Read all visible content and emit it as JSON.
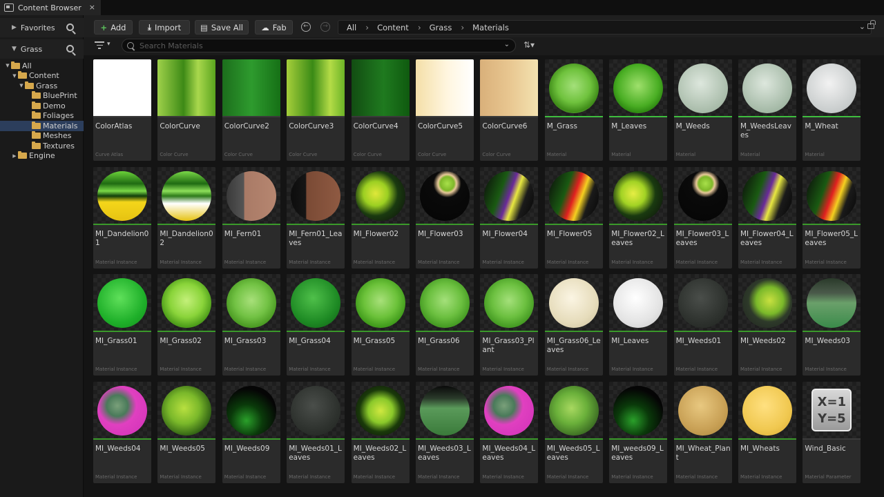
{
  "tab": {
    "title": "Content Browser",
    "close": "×"
  },
  "sidebar": {
    "favorites": "Favorites",
    "grass": "Grass",
    "tree": [
      {
        "label": "All",
        "level": 0,
        "twisty": "▼"
      },
      {
        "label": "Content",
        "level": 1,
        "twisty": "▼"
      },
      {
        "label": "Grass",
        "level": 2,
        "twisty": "▼"
      },
      {
        "label": "BluePrint",
        "level": 3,
        "twisty": ""
      },
      {
        "label": "Demo",
        "level": 3,
        "twisty": ""
      },
      {
        "label": "Foliages",
        "level": 3,
        "twisty": ""
      },
      {
        "label": "Materials",
        "level": 3,
        "twisty": "",
        "selected": true
      },
      {
        "label": "Meshes",
        "level": 3,
        "twisty": ""
      },
      {
        "label": "Textures",
        "level": 3,
        "twisty": ""
      },
      {
        "label": "Engine",
        "level": 1,
        "twisty": "▶"
      }
    ]
  },
  "toolbar": {
    "add": "Add",
    "import": "Import",
    "save_all": "Save All",
    "fab": "Fab",
    "breadcrumb": [
      "All",
      "Content",
      "Grass",
      "Materials"
    ]
  },
  "search": {
    "placeholder": "Search Materials"
  },
  "assets": [
    {
      "name": "ColorAtlas",
      "type": "Curve Atlas",
      "kind": "flat",
      "fill": "#ffffff",
      "bar": "#3a3a3a"
    },
    {
      "name": "ColorCurve",
      "type": "Color Curve",
      "kind": "flat",
      "fill": "linear-gradient(90deg,#9fd14a,#3d8a16 45%,#a9d84d 70%,#5aa41e)",
      "bar": "#3a3a3a"
    },
    {
      "name": "ColorCurve2",
      "type": "Color Curve",
      "kind": "flat",
      "fill": "linear-gradient(90deg,#1c6e1c,#2e9b2e 50%,#167016)",
      "bar": "#3a3a3a"
    },
    {
      "name": "ColorCurve3",
      "type": "Color Curve",
      "kind": "flat",
      "fill": "linear-gradient(90deg,#a6cf3a,#3a8a16 45%,#b4dc47 75%,#6cb326)",
      "bar": "#3a3a3a"
    },
    {
      "name": "ColorCurve4",
      "type": "Color Curve",
      "kind": "flat",
      "fill": "linear-gradient(90deg,#124d12,#1f7a1f 55%,#0f5a0f)",
      "bar": "#3a3a3a"
    },
    {
      "name": "ColorCurve5",
      "type": "Color Curve",
      "kind": "flat",
      "fill": "linear-gradient(90deg,#f4dfa8,#fff6e0 55%,#ffffff)",
      "bar": "#3a3a3a"
    },
    {
      "name": "ColorCurve6",
      "type": "Color Curve",
      "kind": "flat",
      "fill": "linear-gradient(90deg,#d9b07a,#e8c690 50%,#f3e2b0)",
      "bar": "#3a3a3a"
    },
    {
      "name": "M_Grass",
      "type": "Material",
      "fill": "radial-gradient(circle at 50% 45%,#a4e07a 0%,#6fc23d 45%,#3e8a18 70%,#b4ef9a 100%)",
      "bar": "#3fbf3f"
    },
    {
      "name": "M_Leaves",
      "type": "Material",
      "fill": "radial-gradient(circle at 50% 45%,#9fe06c 0%,#4aae24 55%,#2f8a12 72%,#b8f39a 100%)",
      "bar": "#3fbf3f"
    },
    {
      "name": "M_Weeds",
      "type": "Material",
      "fill": "radial-gradient(circle at 45% 40%,#dde7dd,#a9bcaa 70%,#8ba08b)",
      "bar": "#3fbf3f"
    },
    {
      "name": "M_WeedsLeaves",
      "type": "Material",
      "fill": "radial-gradient(circle at 45% 40%,#dde7dd,#a4b9a6 70%,#889f8a)",
      "bar": "#3fbf3f"
    },
    {
      "name": "M_Wheat",
      "type": "Material",
      "fill": "radial-gradient(circle at 45% 40%,#f2f2f2,#c8cccc 70%,#a6aaaa)",
      "bar": "#3fbf3f"
    },
    {
      "name": "MI_Dandelion01",
      "type": "Material Instance",
      "fill": "linear-gradient(180deg,#6bd13a 0%,#1f6b12 25%,#7ad847 40%,#0f3d0a 50%,#f4d61a 62%,#e6c212 100%)",
      "bar": "#3a9a2a"
    },
    {
      "name": "MI_Dandelion02",
      "type": "Material Instance",
      "fill": "linear-gradient(180deg,#7ad847 0%,#1f6b12 25%,#8ee05a 40%,#2d7a1a 50%,#ffffff 65%,#e6c212 100%)",
      "bar": "#3a9a2a"
    },
    {
      "name": "MI_Fern01",
      "type": "Material Instance",
      "fill": "linear-gradient(90deg,#3a3a3a 0%,#555 35%,#a97a66 36%,#b68670 100%)",
      "bar": "#3a9a2a"
    },
    {
      "name": "MI_Fern01_Leaves",
      "type": "Material Instance",
      "fill": "linear-gradient(90deg,#0d0d0d 0%,#151515 30%,#7a4a35 32%,#8f5a42 100%)",
      "bar": "#3a9a2a"
    },
    {
      "name": "MI_Flower02",
      "type": "Material Instance",
      "fill": "radial-gradient(circle at 40% 45%,#dfe83a 0%,#9ccf22 30%,#1a3a10 55%,#0a0a0a 100%)",
      "bar": "#3a9a2a"
    },
    {
      "name": "MI_Flower03",
      "type": "Material Instance",
      "fill": "radial-gradient(circle at 55% 25%,#a8e04a 0%,#7fb82a 15%,#e8c89a 20%,#0a0a0a 30%,#050505 100%)",
      "bar": "#3a9a2a"
    },
    {
      "name": "MI_Flower04",
      "type": "Material Instance",
      "fill": "linear-gradient(110deg,#0a0a0a 0%,#1a5a12 35%,#6a2a9a 50%,#e8e840 60%,#1a1a1a 75%,#050505 100%)",
      "bar": "#3a9a2a"
    },
    {
      "name": "MI_Flower05",
      "type": "Material Instance",
      "fill": "linear-gradient(110deg,#0a0a0a 0%,#1a5a12 35%,#e02020 50%,#f4d020 62%,#1a1a1a 75%,#050505 100%)",
      "bar": "#3a9a2a"
    },
    {
      "name": "MI_Flower02_Leaves",
      "type": "Material Instance",
      "fill": "radial-gradient(circle at 40% 45%,#e6ee44 0%,#a2d224 30%,#1a3a10 55%,#0a0a0a 100%)",
      "bar": "#3a9a2a"
    },
    {
      "name": "MI_Flower03_Leaves",
      "type": "Material Instance",
      "fill": "radial-gradient(circle at 55% 25%,#a8e04a 0%,#7fb82a 15%,#e8c89a 20%,#0a0a0a 30%,#050505 100%)",
      "bar": "#3a9a2a"
    },
    {
      "name": "MI_Flower04_Leaves",
      "type": "Material Instance",
      "fill": "linear-gradient(110deg,#0a0a0a 0%,#1a5a12 35%,#6a2a9a 50%,#e8e840 60%,#1a1a1a 75%,#050505 100%)",
      "bar": "#3a9a2a"
    },
    {
      "name": "MI_Flower05_Leaves",
      "type": "Material Instance",
      "fill": "linear-gradient(110deg,#0a0a0a 0%,#1a5a12 35%,#e02020 50%,#f4d020 62%,#1a1a1a 75%,#050505 100%)",
      "bar": "#3a9a2a"
    },
    {
      "name": "MI_Grass01",
      "type": "Material Instance",
      "fill": "radial-gradient(circle at 45% 40%,#5fe05a,#1fb02a 60%,#128a1a)",
      "bar": "#3a9a2a"
    },
    {
      "name": "MI_Grass02",
      "type": "Material Instance",
      "fill": "radial-gradient(circle at 50% 45%,#c4f07a 0%,#8ad43a 45%,#4a9a18 72%,#d4f7a8 100%)",
      "bar": "#3a9a2a"
    },
    {
      "name": "MI_Grass03",
      "type": "Material Instance",
      "fill": "radial-gradient(circle at 50% 45%,#a8e07a 0%,#72c244 45%,#4a9a22 72%,#c4f0a8 100%)",
      "bar": "#3a9a2a"
    },
    {
      "name": "MI_Grass04",
      "type": "Material Instance",
      "fill": "radial-gradient(circle at 45% 40%,#4fc04a,#1e8a24 60%,#0e5a14)",
      "bar": "#3a9a2a"
    },
    {
      "name": "MI_Grass05",
      "type": "Material Instance",
      "fill": "radial-gradient(circle at 50% 45%,#a8e07a 0%,#6cc23a 45%,#3f9a1a 72%,#c8f4a8 100%)",
      "bar": "#3a9a2a"
    },
    {
      "name": "MI_Grass06",
      "type": "Material Instance",
      "fill": "radial-gradient(circle at 50% 45%,#a4e07a 0%,#6cc040 45%,#449a22 72%,#c8f4a8 100%)",
      "bar": "#3a9a2a"
    },
    {
      "name": "MI_Grass03_Plant",
      "type": "Material Instance",
      "fill": "radial-gradient(circle at 50% 45%,#a4e07a 0%,#6cc040 45%,#449a22 72%,#c8f4a8 100%)",
      "bar": "#3a9a2a"
    },
    {
      "name": "MI_Grass06_Leaves",
      "type": "Material Instance",
      "fill": "radial-gradient(circle at 45% 40%,#fbf5e3,#e6dcbb 60%,#c8bd98)",
      "bar": "#3a9a2a"
    },
    {
      "name": "MI_Leaves",
      "type": "Material Instance",
      "fill": "radial-gradient(circle at 45% 40%,#ffffff,#e4e4e4 60%,#c4c4c4)",
      "bar": "#3a9a2a"
    },
    {
      "name": "MI_Weeds01",
      "type": "Material Instance",
      "fill": "radial-gradient(circle at 45% 40%,#4a4e4a,#2e322e 60%,#1e221e)",
      "bar": "#3a9a2a"
    },
    {
      "name": "MI_Weeds02",
      "type": "Material Instance",
      "fill": "radial-gradient(circle at 55% 45%,#c8e040 0%,#7ab82a 35%,#2e3a2a 55%,#1e221e 100%)",
      "bar": "#3a9a2a"
    },
    {
      "name": "MI_Weeds03",
      "type": "Material Instance",
      "fill": "linear-gradient(180deg,#2a3a2a 0%,#4a5a4a 30%,#6aa06a 50%,#3a8a4a 100%)",
      "bar": "#3a9a2a"
    },
    {
      "name": "MI_Weeds04",
      "type": "Material Instance",
      "fill": "radial-gradient(circle at 40% 40%,#7aa07a 0%,#4a7a5a 25%,#e040c0 45%,#d030b8 100%)",
      "bar": "#3a9a2a"
    },
    {
      "name": "MI_Weeds05",
      "type": "Material Instance",
      "fill": "radial-gradient(circle at 45% 45%,#b8e040 0%,#7ab82a 40%,#2a5a12 75%,#1a3a0a 100%)",
      "bar": "#3a9a2a"
    },
    {
      "name": "MI_Weeds09",
      "type": "Material Instance",
      "fill": "radial-gradient(circle at 40% 70%,#2aa02a 0%,#0a3a0a 35%,#050505 70%)",
      "bar": "#3a9a2a"
    },
    {
      "name": "MI_Weeds01_Leaves",
      "type": "Material Instance",
      "fill": "radial-gradient(circle at 45% 40%,#4a4e4a,#2e322e 60%,#1e221e)",
      "bar": "#3a9a2a"
    },
    {
      "name": "MI_Weeds02_Leaves",
      "type": "Material Instance",
      "fill": "radial-gradient(circle at 50% 50%,#d0e840 0%,#8ac82a 35%,#1a3a0a 60%,#0a0a0a 100%)",
      "bar": "#3a9a2a"
    },
    {
      "name": "MI_Weeds03_Leaves",
      "type": "Material Instance",
      "fill": "linear-gradient(180deg,#0a0a0a 0%,#2a3a2a 25%,#5a9a5a 45%,#3a7a3a 100%)",
      "bar": "#3a9a2a"
    },
    {
      "name": "MI_Weeds04_Leaves",
      "type": "Material Instance",
      "fill": "radial-gradient(circle at 40% 40%,#7aa07a 0%,#4a7a5a 25%,#e040c0 45%,#d030b8 100%)",
      "bar": "#3a9a2a"
    },
    {
      "name": "MI_Weeds05_Leaves",
      "type": "Material Instance",
      "fill": "radial-gradient(circle at 45% 45%,#a8d860 0%,#6ab03a 40%,#3a6a22 75%,#2a4a1a 100%)",
      "bar": "#3a9a2a"
    },
    {
      "name": "MI_weeds09_Leaves",
      "type": "Material Instance",
      "fill": "radial-gradient(circle at 40% 70%,#2aa02a 0%,#0a3a0a 35%,#050505 70%)",
      "bar": "#3a9a2a"
    },
    {
      "name": "MI_Wheat_Plant",
      "type": "Material Instance",
      "fill": "radial-gradient(circle at 45% 40%,#e8c880,#c8a055 60%,#a8843a)",
      "bar": "#3a9a2a"
    },
    {
      "name": "MI_Wheats",
      "type": "Material Instance",
      "fill": "radial-gradient(circle at 45% 40%,#ffe080,#f0c850 60%,#d8a830)",
      "bar": "#3a9a2a"
    },
    {
      "name": "Wind_Basic",
      "type": "Material Parameter",
      "kind": "badge",
      "badge": [
        "X=1",
        "Y=5"
      ],
      "bar": "#3a3a3a"
    }
  ]
}
